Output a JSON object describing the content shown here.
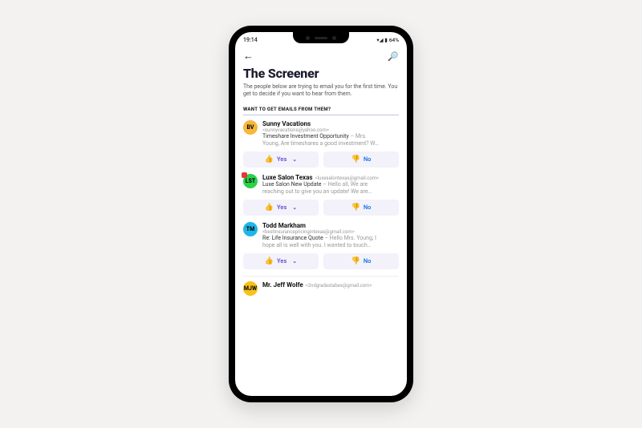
{
  "status": {
    "time": "19:14",
    "battery": "64%",
    "icons": "▾◢ ▮"
  },
  "header": {
    "title": "The Screener",
    "subtitle": "The people below are trying to email you for the first time. You get to decide if you want to hear from them."
  },
  "section_head": "WANT TO GET EMAILS FROM THEM?",
  "buttons": {
    "yes": "Yes",
    "no": "No"
  },
  "senders": [
    {
      "initials": "BV",
      "avatar_color": "#f6b73c",
      "name": "Sunny Vacations",
      "email": "<sunnyvacations@yahoo.com>",
      "subject": "Timeshare Investment Opportunity",
      "preview1": " – Mrs.",
      "preview2": "Young, Are timeshares a good investment? W…",
      "badge": false
    },
    {
      "initials": "LST",
      "avatar_color": "#2bd14a",
      "name": "Luxe Salon Texas",
      "email": "<luxesalontexas@gmail.com>",
      "subject": "Luxe Salon New Update",
      "preview1": " – Hello all, We are",
      "preview2": "reaching out to give you an update! We are…",
      "badge": true
    },
    {
      "initials": "TM",
      "avatar_color": "#1fb6e8",
      "name": "Todd Markham",
      "email": "<bestinsurancepricingintexas@gmail.com>",
      "subject": "Re: Life Insurance Quote",
      "preview1": " – Hello Mrs. Young, I",
      "preview2": "hope all is well with you. I wanted to touch…",
      "badge": false
    },
    {
      "initials": "MJW",
      "avatar_color": "#f6c21b",
      "name": "Mr. Jeff Wolfe",
      "email": "<2ndgradestabes@gmail.com>",
      "subject": "",
      "preview1": "",
      "preview2": "",
      "badge": false
    }
  ]
}
